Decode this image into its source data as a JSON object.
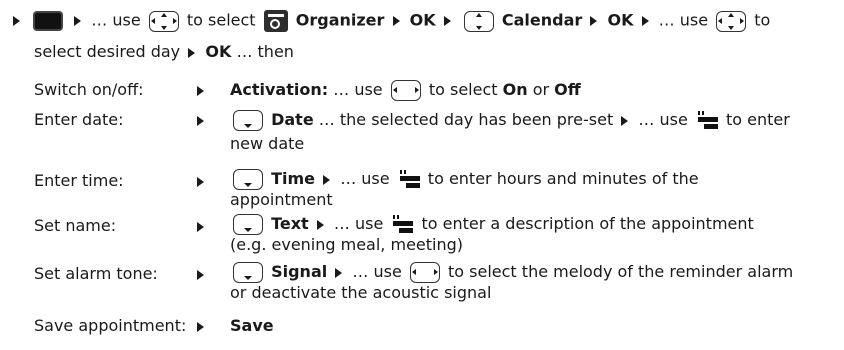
{
  "intro": {
    "use1": "… use",
    "to_select": "to select",
    "organizer": "Organizer",
    "ok1": "OK",
    "calendar": "Calendar",
    "ok2": "OK",
    "use2": "… use",
    "to2": "to",
    "line2_a": "select desired day",
    "ok3": "OK",
    "then": "… then"
  },
  "rows": [
    {
      "label": "Switch on/off:",
      "bold": "Activation:",
      "t1": "… use",
      "t2": "to select",
      "on": "On",
      "or": "or",
      "off": "Off"
    },
    {
      "label": "Enter date:",
      "bold": "Date",
      "t1": "… the selected day has been pre-set",
      "t2": "… use",
      "t3": "to enter",
      "t4": "new date"
    },
    {
      "label": "Enter time:",
      "bold": "Time",
      "t1": "… use",
      "t2": "to enter hours and minutes of the",
      "t3": "appointment"
    },
    {
      "label": "Set name:",
      "bold": "Text",
      "t1": "… use",
      "t2": "to enter a description of the appointment",
      "t3": "(e.g. evening meal, meeting)"
    },
    {
      "label": "Set alarm tone:",
      "bold": "Signal",
      "t1": "… use",
      "t2": "to select the melody of the reminder alarm",
      "t3": "or deactivate the acoustic signal"
    },
    {
      "label": "Save appointment:",
      "bold": "Save"
    }
  ],
  "icons": {
    "menu_key": "menu-key-icon",
    "nav_key": "navigation-key-icon",
    "organizer": "organizer-icon",
    "down_key": "down-key-icon",
    "keypad": "keypad-icon"
  }
}
